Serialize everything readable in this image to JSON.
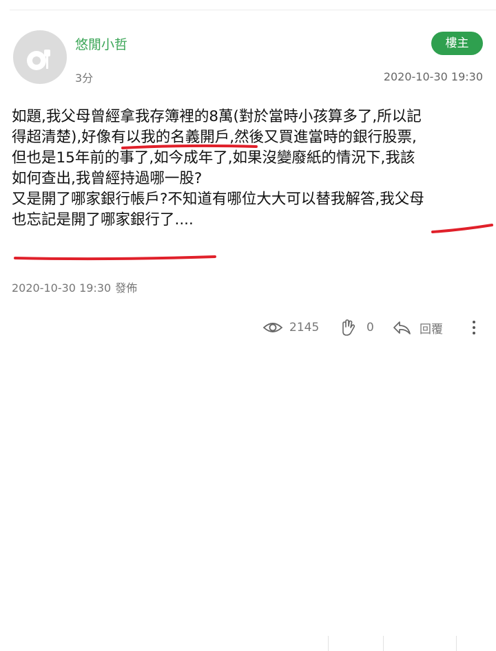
{
  "post": {
    "author": "悠閒小哲",
    "time_ago": "3分",
    "op_badge": "樓主",
    "date": "2020-10-30 19:30",
    "content_lines": [
      "如題,我父母曾經拿我存簿裡的8萬(對於當時小孩算多了,所以記",
      "得超清楚),好像有以我的名義開戶,然後又買進當時的銀行股票,",
      "但也是15年前的事了,如今成年了,如果沒變廢紙的情況下,我該",
      "如何查出,我曾經持過哪一股?",
      "又是開了哪家銀行帳戶?不知道有哪位大大可以替我解答,我父母",
      "也忘記是開了哪家銀行了...."
    ],
    "published_time": "2020-10-30 19:30",
    "published_label": "發佈"
  },
  "actions": {
    "views": "2145",
    "likes": "0",
    "reply_label": "回覆"
  },
  "colors": {
    "author_green": "#3aa556",
    "badge_green": "#2fa04f",
    "annotation_red": "#e0202a"
  },
  "icons": [
    "avatar-icon",
    "eye-icon",
    "clap-icon",
    "reply-icon",
    "more-icon"
  ]
}
